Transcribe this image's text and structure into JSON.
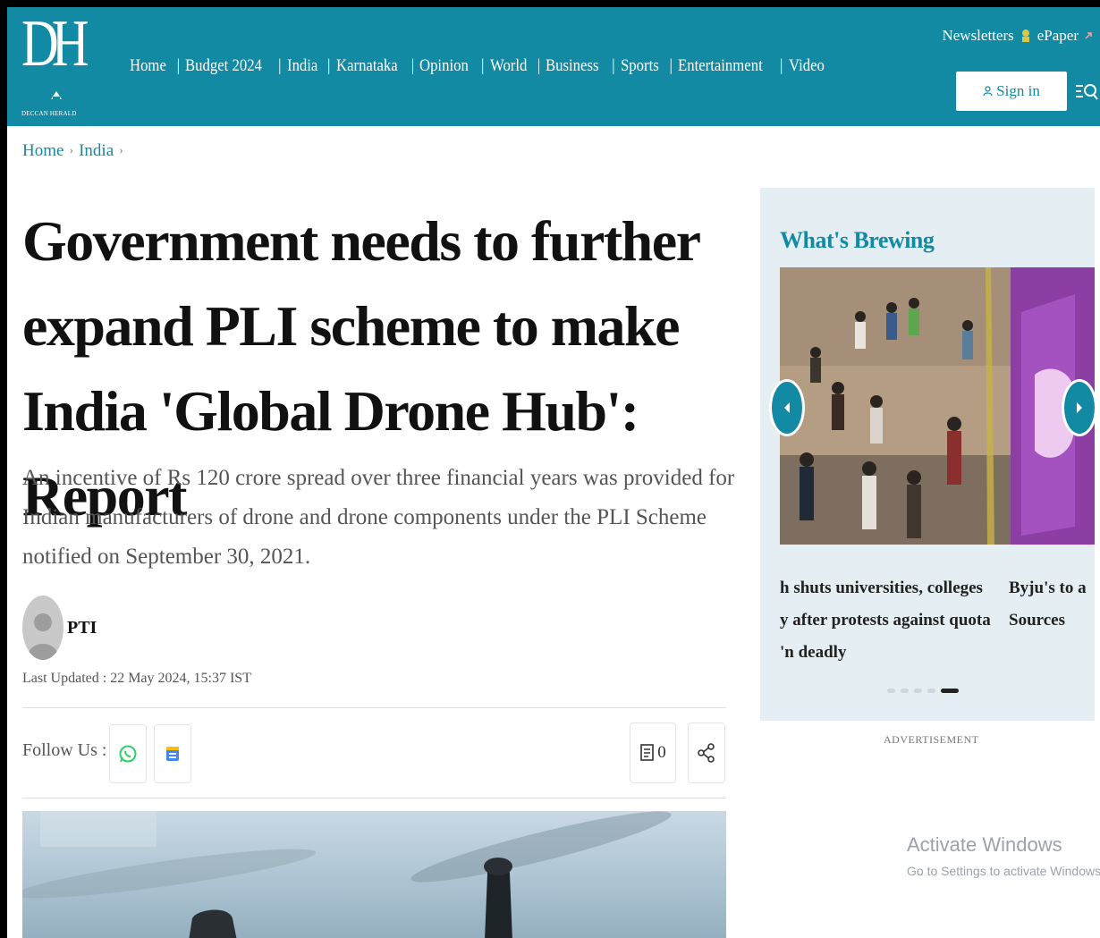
{
  "header": {
    "logo_text": "DH",
    "logo_subtitle": "DECCAN HERALD",
    "nav": [
      "Home",
      "Budget 2024",
      "India",
      "Karnataka",
      "Opinion",
      "World",
      "Business",
      "Sports",
      "Entertainment",
      "Video"
    ],
    "newsletters_label": "Newsletters",
    "epaper_label": "ePaper",
    "signin_label": "Sign in"
  },
  "breadcrumb": [
    "Home",
    "India"
  ],
  "article": {
    "headline": "Government needs to further expand PLI scheme to make India 'Global Drone Hub': Report",
    "summary": "An incentive of Rs 120 crore spread over three financial years was provided for Indian manufacturers of drone and drone components under the PLI Scheme notified on September 30, 2021.",
    "author": "PTI",
    "last_updated": "Last Updated : 22 May 2024, 15:37 IST",
    "follow_label": "Follow Us :",
    "comment_count": "0"
  },
  "sidebar": {
    "title": "What's Brewing",
    "captions": [
      [
        "h shuts universities, colleges",
        "y after protests against quota",
        "'n deadly"
      ],
      [
        "Byju's to a",
        "Sources"
      ]
    ],
    "dots": 5,
    "active_dot": 4,
    "advertisement_label": "ADVERTISEMENT"
  },
  "os_overlay": {
    "title": "Activate Windows",
    "subtitle": "Go to Settings to activate Windows."
  },
  "colors": {
    "brand": "#138aa3",
    "whatsapp": "#25d366"
  }
}
